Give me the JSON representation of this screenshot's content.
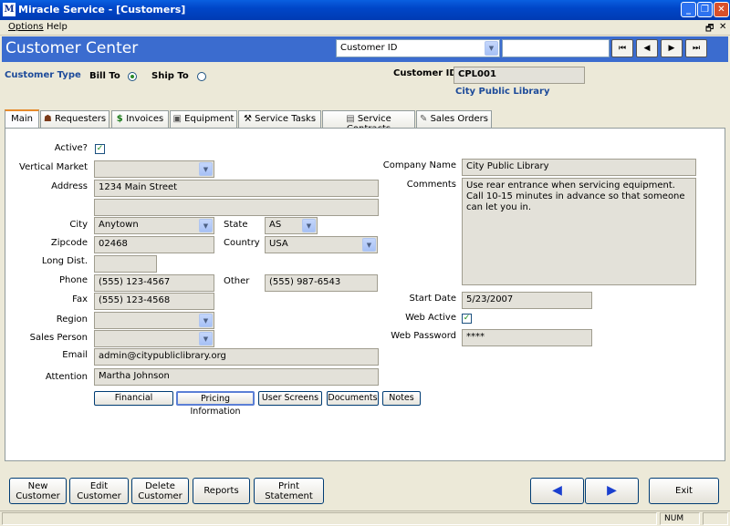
{
  "window": {
    "title": "Miracle Service - [Customers]",
    "app_glyph": "M",
    "min": "_",
    "restore": "❐",
    "close": "✕"
  },
  "menu": {
    "options": "Options",
    "help": "Help",
    "restore_glyph": "🗗",
    "close_glyph": "✕"
  },
  "header": {
    "title": "Customer Center",
    "search_field": "Customer ID",
    "search_value": "",
    "nav": {
      "first": "⏮",
      "prev": "◀",
      "next": "▶",
      "last": "⏭"
    }
  },
  "customer": {
    "type_label": "Customer Type",
    "bill_to": "Bill To",
    "ship_to": "Ship To",
    "bill_to_selected": true,
    "id_label": "Customer ID",
    "id": "CPL001",
    "name": "City Public Library"
  },
  "tabs": [
    {
      "label": "Main",
      "icon": "none"
    },
    {
      "label": "Requesters",
      "icon": "people-icon"
    },
    {
      "label": "Invoices",
      "icon": "dollar-icon"
    },
    {
      "label": "Equipment",
      "icon": "equipment-icon"
    },
    {
      "label": "Service Tasks",
      "icon": "tools-icon"
    },
    {
      "label": "Service Contracts",
      "icon": "contract-icon"
    },
    {
      "label": "Sales Orders",
      "icon": "order-icon"
    }
  ],
  "form": {
    "active_label": "Active?",
    "active": true,
    "vertical_market_label": "Vertical Market",
    "vertical_market": "",
    "address_label": "Address",
    "address1": "1234 Main Street",
    "address2": "",
    "city_label": "City",
    "city": "Anytown",
    "state_label": "State",
    "state": "AS",
    "zip_label": "Zipcode",
    "zip": "02468",
    "country_label": "Country",
    "country": "USA",
    "longdist_label": "Long Dist.",
    "longdist": "",
    "phone_label": "Phone",
    "phone": "(555) 123-4567",
    "other_label": "Other",
    "other": "(555) 987-6543",
    "fax_label": "Fax",
    "fax": "(555) 123-4568",
    "region_label": "Region",
    "region": "",
    "salesperson_label": "Sales Person",
    "salesperson": "",
    "email_label": "Email",
    "email": "admin@citypubliclibrary.org",
    "attention_label": "Attention",
    "attention": "Martha Johnson",
    "company_label": "Company Name",
    "company": "City Public Library",
    "comments_label": "Comments",
    "comments": "Use rear entrance when servicing equipment.  Call 10-15 minutes in advance so that someone can let you in.",
    "startdate_label": "Start Date",
    "startdate": "5/23/2007",
    "webactive_label": "Web Active",
    "webactive": true,
    "webpassword_label": "Web Password",
    "webpassword": "****",
    "buttons": {
      "financial": "Financial",
      "pricing": "Pricing Information",
      "userscreens": "User Screens",
      "documents": "Documents",
      "notes": "Notes"
    }
  },
  "footer": {
    "new_customer": "New Customer",
    "edit_customer": "Edit Customer",
    "delete_customer": "Delete Customer",
    "reports": "Reports",
    "print_statement": "Print Statement",
    "back": "◀",
    "forward": "▶",
    "exit": "Exit"
  },
  "status": {
    "num": "NUM"
  },
  "colors": {
    "header_blue": "#3b6ccf",
    "label_blue": "#1c4a9a",
    "arrow_blue": "#1a3fcf"
  }
}
